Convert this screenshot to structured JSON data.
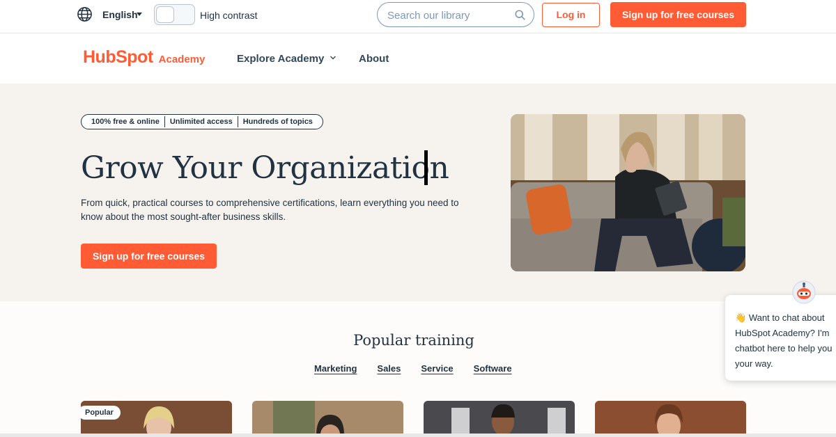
{
  "utility": {
    "language": "English",
    "high_contrast_label": "High contrast",
    "search_placeholder": "Search our library",
    "login_label": "Log in",
    "signup_label": "Sign up for free courses"
  },
  "nav": {
    "logo_wordmark": "HubSpot",
    "logo_sub": "Academy",
    "explore_label": "Explore Academy",
    "about_label": "About"
  },
  "hero": {
    "pills": [
      "100% free & online",
      "Unlimited access",
      "Hundreds of topics"
    ],
    "headline": "Grow Your Organization",
    "lede": "From quick, practical courses to comprehensive certifications, learn everything you need to know about the most sought-after business skills.",
    "cta_label": "Sign up for free courses"
  },
  "popular": {
    "title": "Popular training",
    "tabs": [
      "Marketing",
      "Sales",
      "Service",
      "Software"
    ],
    "first_card_badge": "Popular"
  },
  "chat": {
    "emoji": "👋",
    "text": "Want to chat about\nHubSpot Academy? I'm\nchatbot here to help you\nyour way."
  },
  "colors": {
    "brand_orange": "#ff5c35",
    "navy": "#213343",
    "hero_bg": "#f6f3ee"
  },
  "icons": {
    "globe": "globe-icon",
    "search": "search-icon",
    "chevron": "chevron-down-icon",
    "chatbot": "chatbot-avatar-icon"
  }
}
